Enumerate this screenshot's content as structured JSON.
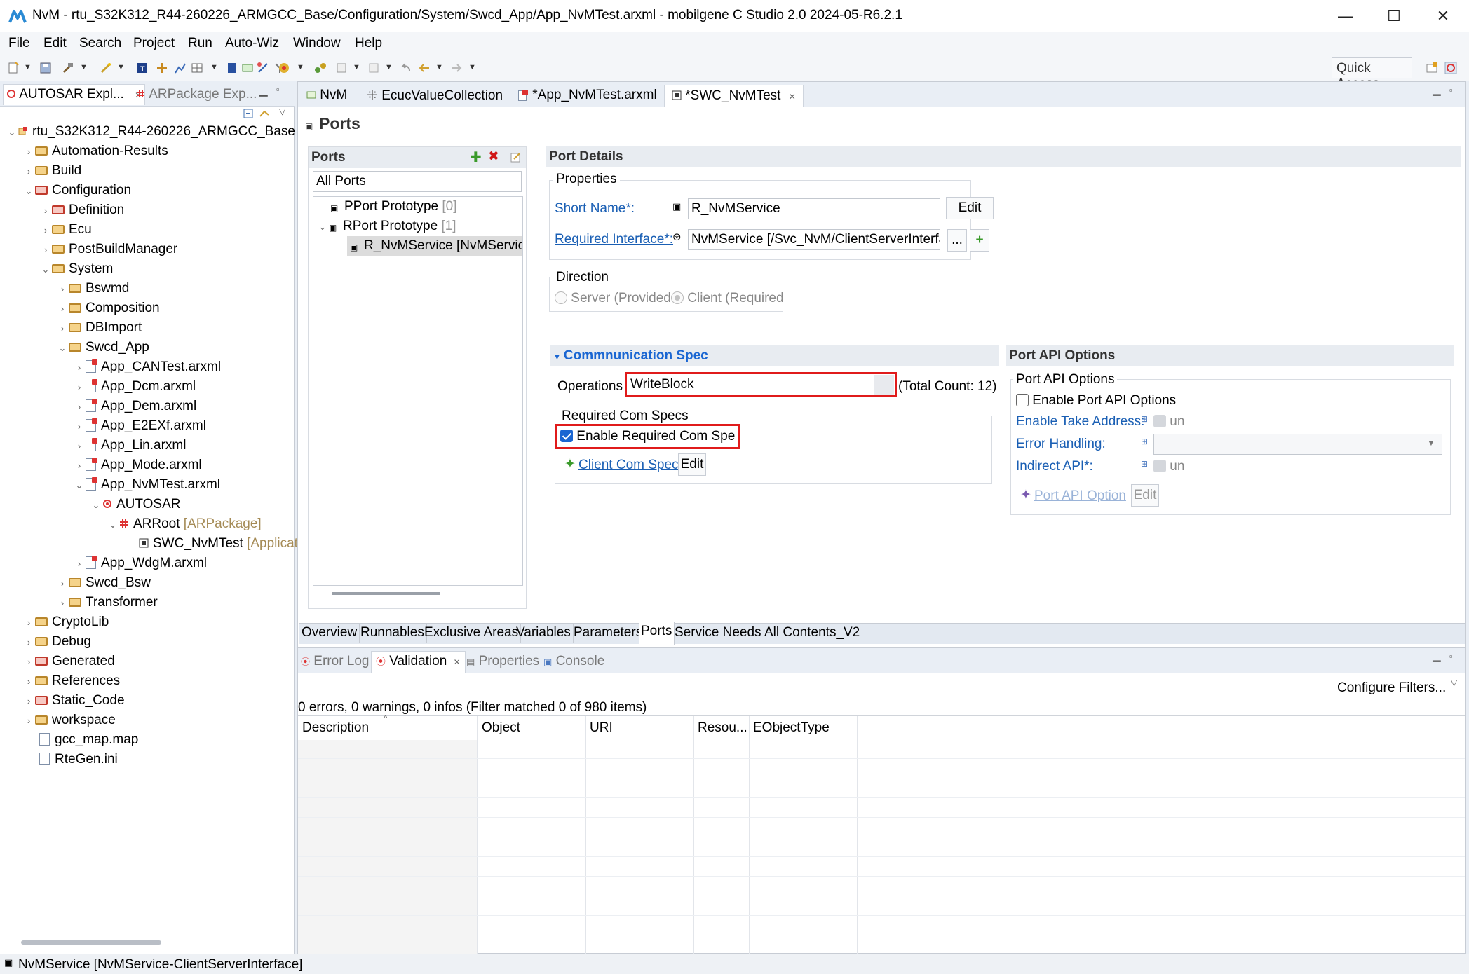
{
  "window": {
    "title": "NvM - rtu_S32K312_R44-260226_ARMGCC_Base/Configuration/System/Swcd_App/App_NvMTest.arxml - mobilgene C Studio 2.0 2024-05-R6.2.1",
    "minimize": "—",
    "maximize": "☐",
    "close": "✕"
  },
  "menu": [
    "File",
    "Edit",
    "Search",
    "Project",
    "Run",
    "Auto-Wiz",
    "Window",
    "Help"
  ],
  "toolbar": {
    "quick_access": "Quick Access"
  },
  "explorer": {
    "tabs": [
      "AUTOSAR Expl...",
      "ARPackage Exp..."
    ],
    "tree": [
      {
        "label": "rtu_S32K312_R44-260226_ARMGCC_Base",
        "suffix": ""
      },
      {
        "label": "Automation-Results",
        "suffix": ""
      },
      {
        "label": "Build",
        "suffix": ""
      },
      {
        "label": "Configuration",
        "suffix": ""
      },
      {
        "label": "Definition",
        "suffix": ""
      },
      {
        "label": "Ecu",
        "suffix": ""
      },
      {
        "label": "PostBuildManager",
        "suffix": ""
      },
      {
        "label": "System",
        "suffix": ""
      },
      {
        "label": "Bswmd",
        "suffix": ""
      },
      {
        "label": "Composition",
        "suffix": ""
      },
      {
        "label": "DBImport",
        "suffix": ""
      },
      {
        "label": "Swcd_App",
        "suffix": ""
      },
      {
        "label": "App_CANTest.arxml",
        "suffix": ""
      },
      {
        "label": "App_Dcm.arxml",
        "suffix": ""
      },
      {
        "label": "App_Dem.arxml",
        "suffix": ""
      },
      {
        "label": "App_E2EXf.arxml",
        "suffix": ""
      },
      {
        "label": "App_Lin.arxml",
        "suffix": ""
      },
      {
        "label": "App_Mode.arxml",
        "suffix": ""
      },
      {
        "label": "App_NvMTest.arxml",
        "suffix": ""
      },
      {
        "label": "AUTOSAR",
        "suffix": ""
      },
      {
        "label": "ARRoot",
        "suffix": " [ARPackage]"
      },
      {
        "label": "SWC_NvMTest",
        "suffix": " [Applicat"
      },
      {
        "label": "App_WdgM.arxml",
        "suffix": ""
      },
      {
        "label": "Swcd_Bsw",
        "suffix": ""
      },
      {
        "label": "Transformer",
        "suffix": ""
      },
      {
        "label": "CryptoLib",
        "suffix": ""
      },
      {
        "label": "Debug",
        "suffix": ""
      },
      {
        "label": "Generated",
        "suffix": ""
      },
      {
        "label": "References",
        "suffix": ""
      },
      {
        "label": "Static_Code",
        "suffix": ""
      },
      {
        "label": "workspace",
        "suffix": ""
      },
      {
        "label": "gcc_map.map",
        "suffix": ""
      },
      {
        "label": "RteGen.ini",
        "suffix": ""
      }
    ]
  },
  "editor": {
    "tabs": [
      "NvM",
      "EcucValueCollection",
      "*App_NvMTest.arxml",
      "*SWC_NvMTest"
    ],
    "page_title": "Ports",
    "ports": {
      "header": "Ports",
      "filter": "All Ports",
      "items": [
        {
          "label": "PPort Prototype",
          "count": "[0]"
        },
        {
          "label": "RPort Prototype",
          "count": "[1]"
        },
        {
          "label": "R_NvMService [NvMService",
          "count": ""
        }
      ]
    },
    "details": {
      "header": "Port Details",
      "properties_label": "Properties",
      "short_name_label": "Short Name*:",
      "short_name_value": "R_NvMService",
      "edit_label": "Edit",
      "required_interface_label": "Required Interface*:",
      "required_interface_value": "NvMService [/Svc_NvM/ClientServerInterfac",
      "browse_label": "...",
      "add_label": "+",
      "direction_label": "Direction",
      "server_label": "Server (Provided",
      "client_label": "Client (Required"
    },
    "comspec": {
      "header": "Commnunication Spec",
      "operations_label": "Operations",
      "operations_value": "WriteBlock",
      "total_count": "(Total Count: 12)",
      "required_com_specs_label": "Required Com Specs",
      "enable_required_label": "Enable Required Com Specs",
      "client_com_spec_label": "Client Com Spec",
      "edit_label": "Edit"
    },
    "port_api": {
      "header": "Port API Options",
      "group_label": "Port API Options",
      "enable_label": "Enable Port API Options",
      "take_address_label": "Enable Take Address:",
      "take_address_value": "un",
      "error_handling_label": "Error Handling:",
      "indirect_api_label": "Indirect API*:",
      "indirect_api_value": "un",
      "port_api_option_label": "Port API Option",
      "edit_label": "Edit"
    },
    "bottom_tabs": [
      "Overview",
      "Runnables",
      "Exclusive Areas",
      "Variables",
      "Parameters",
      "Ports",
      "Service Needs",
      "All Contents_V2"
    ]
  },
  "validation": {
    "tabs": [
      "Error Log",
      "Validation",
      "Properties",
      "Console"
    ],
    "configure_filters": "Configure Filters...",
    "summary": "0 errors, 0 warnings, 0 infos (Filter matched 0 of 980 items)",
    "columns": [
      "Description",
      "Object",
      "URI",
      "Resou...",
      "EObjectType"
    ]
  },
  "status": {
    "text": "NvMService [NvMService-ClientServerInterface]"
  },
  "colors": {
    "accent": "#1a66d2",
    "link": "#1a5fb4",
    "highlight_border": "#e01b1b"
  }
}
